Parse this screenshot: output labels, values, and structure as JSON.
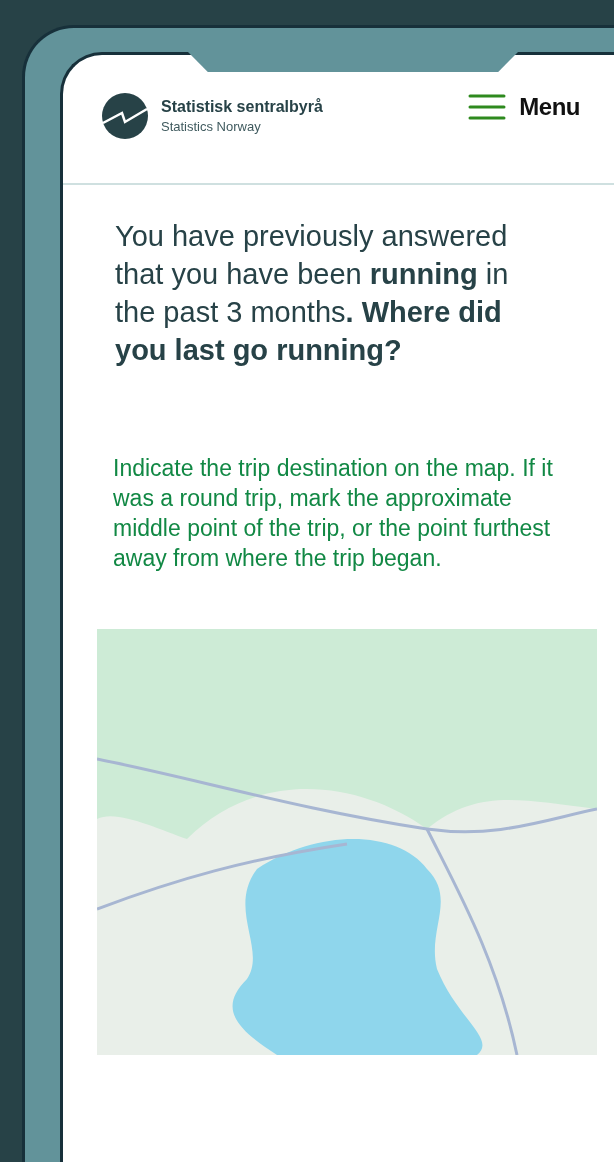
{
  "header": {
    "org_name": "Statistisk sentralbyrå",
    "org_subtitle": "Statistics Norway",
    "menu_label": "Menu"
  },
  "question": "You have previously answered that you have been **running** in the past 3 months**. Where did you last go running?**",
  "instruction": "Indicate the trip destination on the map. If it was a round trip, mark the approximate middle point of the trip, or the point furthest away from where the trip began."
}
